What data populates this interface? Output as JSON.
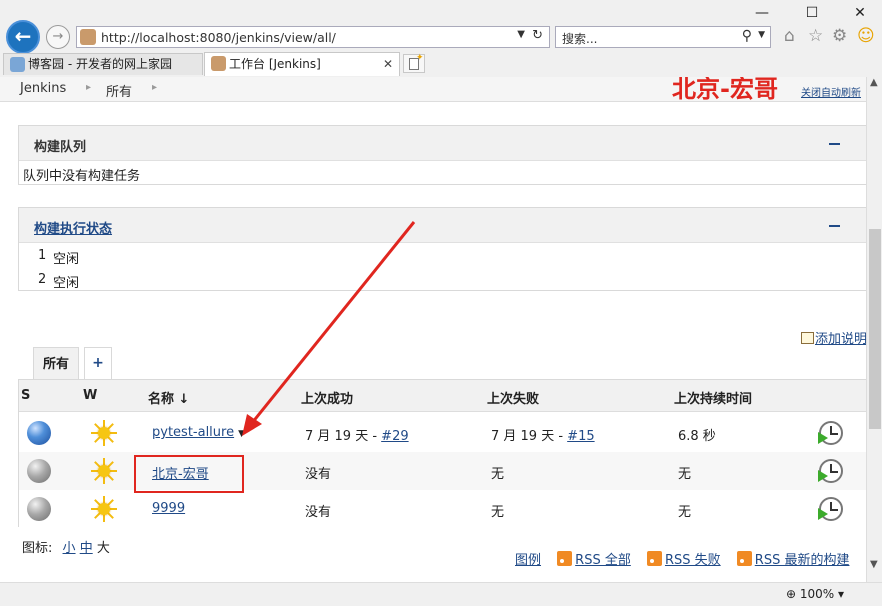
{
  "browser": {
    "address_url": "http://localhost:8080/jenkins/view/all/",
    "search_placeholder": "搜索...",
    "tabs": [
      {
        "label": "博客园 - 开发者的网上家园",
        "active": false
      },
      {
        "label": "工作台 [Jenkins]",
        "active": true
      }
    ],
    "zoom": "100%"
  },
  "breadcrumb": [
    "Jenkins",
    "所有"
  ],
  "watermark": "北京-宏哥",
  "auto_refresh_label": "关闭自动刷新",
  "build_queue": {
    "title": "构建队列",
    "empty_text": "队列中没有构建任务"
  },
  "executor_status": {
    "title": "构建执行状态",
    "executors": [
      {
        "num": "1",
        "state": "空闲"
      },
      {
        "num": "2",
        "state": "空闲"
      }
    ]
  },
  "add_description_label": "添加说明",
  "view_tabs": {
    "all": "所有",
    "add": "+"
  },
  "table": {
    "headers": {
      "s": "S",
      "w": "W",
      "name": "名称 ↓",
      "last_success": "上次成功",
      "last_failure": "上次失败",
      "last_duration": "上次持续时间"
    },
    "rows": [
      {
        "status": "blue",
        "name": "pytest-allure",
        "last_success": "7 月 19 天 - ",
        "last_success_link": "#29",
        "last_failure": "7 月 19 天 - ",
        "last_failure_link": "#15",
        "duration": "6.8 秒"
      },
      {
        "status": "grey",
        "name": "北京-宏哥",
        "last_success": "没有",
        "last_success_link": "",
        "last_failure": "无",
        "last_failure_link": "",
        "duration": "无"
      },
      {
        "status": "grey",
        "name": "9999",
        "last_success": "没有",
        "last_success_link": "",
        "last_failure": "无",
        "last_failure_link": "",
        "duration": "无"
      }
    ]
  },
  "icon_size": {
    "label": "图标:",
    "small": "小",
    "medium": "中",
    "large": "大"
  },
  "footer_links": {
    "legend": "图例",
    "rss_all": "RSS 全部",
    "rss_failed": "RSS 失败",
    "rss_latest": "RSS 最新的构建"
  },
  "colors": {
    "annotation_red": "#e0261f",
    "link_blue": "#204a87"
  }
}
